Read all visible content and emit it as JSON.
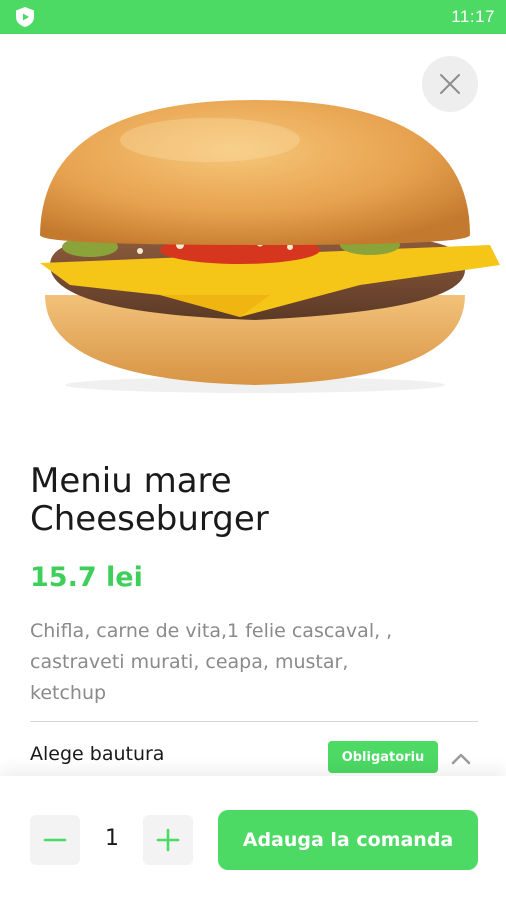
{
  "status_bar": {
    "time": "11:17",
    "app_icon": "shield-play-icon"
  },
  "close_icon": "close-icon",
  "product": {
    "image": "cheeseburger-photo",
    "title_line1": "Meniu mare",
    "title_line2": "Cheeseburger",
    "price": "15.7 lei",
    "description_line1": "Chifla, carne de vita,1 felie cascaval, ,",
    "description_line2": "castraveti murati, ceapa, mustar,",
    "description_line3": "ketchup"
  },
  "option_section": {
    "label": "Alege bautura",
    "badge": "Obligatoriu",
    "toggle_icon": "chevron-up-icon"
  },
  "bottom_bar": {
    "quantity": "1",
    "minus_icon": "minus-icon",
    "plus_icon": "plus-icon",
    "add_label": "Adauga la comanda"
  },
  "colors": {
    "accent": "#4cd964",
    "price": "#3ecf5a",
    "description": "#8a8a8a",
    "text": "#1a1a1a"
  }
}
